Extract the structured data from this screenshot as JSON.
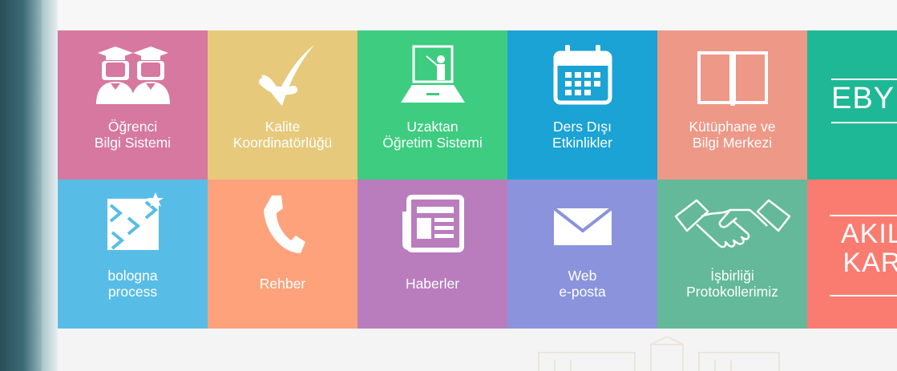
{
  "tiles": [
    {
      "name": "tile-ogrenci-bilgi-sistemi",
      "icon": "graduates-icon",
      "color": "#d6789f",
      "lines": [
        "Öğrenci",
        "Bilgi Sistemi"
      ]
    },
    {
      "name": "tile-kalite-koordinatorlugu",
      "icon": "checkmark-icon",
      "color": "#e6c97b",
      "lines": [
        "Kalite",
        "Koordinatörlüğü"
      ]
    },
    {
      "name": "tile-uzaktan-ogretim",
      "icon": "teacher-board-icon",
      "color": "#3dcc80",
      "lines": [
        "Uzaktan",
        "Öğretim Sistemi"
      ]
    },
    {
      "name": "tile-ders-disi-etkinlikler",
      "icon": "calendar-icon",
      "color": "#1aa3d4",
      "lines": [
        "Ders Dışı",
        "Etkinlikler"
      ]
    },
    {
      "name": "tile-kutuphane",
      "icon": "book-icon",
      "color": "#ee9887",
      "lines": [
        "Kütüphane ve",
        "Bilgi Merkezi"
      ]
    },
    {
      "name": "tile-ebys",
      "icon": "ebys-icon",
      "color": "#1fb896",
      "lines": [],
      "badge": "EBY"
    },
    {
      "name": "tile-bologna",
      "icon": "bologna-icon",
      "color": "#58bde6",
      "lines": [
        "bologna",
        "process"
      ]
    },
    {
      "name": "tile-rehber",
      "icon": "phone-icon",
      "color": "#fda27b",
      "lines": [
        "Rehber"
      ]
    },
    {
      "name": "tile-haberler",
      "icon": "newspaper-icon",
      "color": "#b97dbd",
      "lines": [
        "Haberler"
      ]
    },
    {
      "name": "tile-web-eposta",
      "icon": "envelope-icon",
      "color": "#8a93dc",
      "lines": [
        "Web",
        "e-posta"
      ]
    },
    {
      "name": "tile-isbirligi",
      "icon": "handshake-icon",
      "color": "#63b99a",
      "lines": [
        "İşbirliği",
        "Protokollerimiz"
      ]
    },
    {
      "name": "tile-akil-kar",
      "icon": "akil-icon",
      "color": "#fa7b70",
      "lines": [],
      "badge": "AKIL\nKAR"
    }
  ]
}
